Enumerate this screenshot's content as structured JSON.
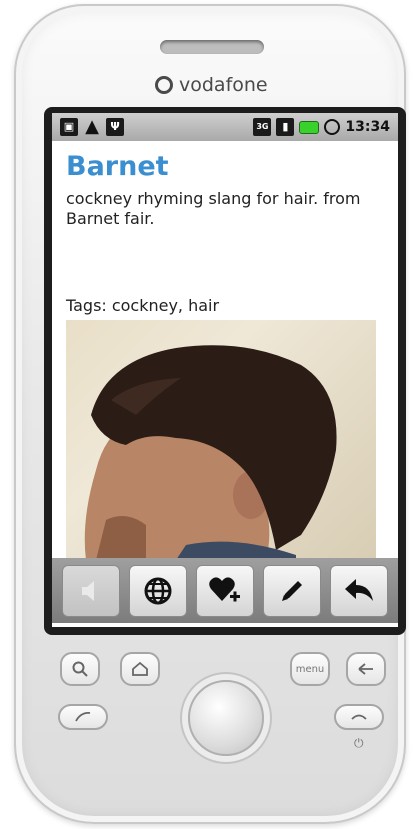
{
  "device": {
    "brand": "vodafone",
    "power_symbol": "⏻"
  },
  "status_bar": {
    "left_icons": [
      "lock-icon",
      "warning-icon",
      "usb-icon"
    ],
    "right_icons": [
      "3g-icon",
      "signal-icon",
      "battery-icon",
      "alarm-icon"
    ],
    "time": "13:34"
  },
  "entry": {
    "title": "Barnet",
    "definition": "cockney rhyming slang for hair. from Barnet fair.",
    "tags_label": "Tags:",
    "tags_value": "cockney, hair"
  },
  "toolbar": {
    "buttons": [
      {
        "name": "speak-button",
        "icon": "speaker-icon",
        "enabled": false
      },
      {
        "name": "web-button",
        "icon": "globe-icon",
        "enabled": true
      },
      {
        "name": "favorite-add-button",
        "icon": "heart-plus-icon",
        "enabled": true
      },
      {
        "name": "edit-button",
        "icon": "pencil-icon",
        "enabled": true
      },
      {
        "name": "back-button",
        "icon": "reply-arrow-icon",
        "enabled": true
      }
    ]
  },
  "hardware_keys": {
    "menu_label": "menu"
  },
  "colors": {
    "title_blue": "#3b8fd0",
    "battery_green": "#39d12c",
    "toolbar_gray": "#8e8e8e"
  }
}
